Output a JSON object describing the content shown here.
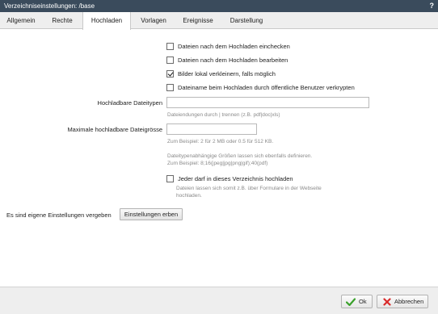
{
  "window": {
    "title": "Verzeichniseinstellungen: /base",
    "help_label": "?"
  },
  "tabs": [
    {
      "label": "Allgemein"
    },
    {
      "label": "Rechte"
    },
    {
      "label": "Hochladen",
      "active": true
    },
    {
      "label": "Vorlagen"
    },
    {
      "label": "Ereignisse"
    },
    {
      "label": "Darstellung"
    }
  ],
  "options": {
    "check_after_upload": {
      "label": "Dateien nach dem Hochladen einchecken",
      "checked": false
    },
    "edit_after_upload": {
      "label": "Dateien nach dem Hochladen bearbeiten",
      "checked": false
    },
    "resize_images": {
      "label": "Bilder lokal verkleinern, falls möglich",
      "checked": true
    },
    "encrypt_filename": {
      "label": "Dateiname beim Hochladen durch öffentliche Benutzer verkrypten",
      "checked": false
    }
  },
  "filetypes": {
    "label": "Hochladbare Dateitypen",
    "value": "",
    "hint": "Dateiendungen durch | trennen (z.B. pdf|doc|xls)"
  },
  "maxsize": {
    "label": "Maximale hochladbare Dateigrösse",
    "value": "",
    "hint1": "Zum Beispiel: 2 für 2 MB oder 0.5 für 512 KB.",
    "hint2": "Dateitypenabhängige Größen lassen sich ebenfalls definieren.",
    "hint3": "Zum Beispiel: 8;16(jpeg|jpg|png|gif);40(pdf)"
  },
  "public_upload": {
    "label": "Jeder darf in dieses Verzeichnis hochladen",
    "checked": false,
    "hint1": "Dateien lassen sich somit z.B. über Formulare in der Webseite",
    "hint2": "hochladen."
  },
  "inherit": {
    "text": "Es sind eigene Einstellungen vergeben",
    "button_label": "Einstellungen erben"
  },
  "footer": {
    "ok_label": "Ok",
    "cancel_label": "Abbrechen"
  },
  "colors": {
    "titlebar": "#3a4b5c",
    "ok_icon": "#3aa12b",
    "cancel_icon": "#d92b2b"
  },
  "icons": {
    "ok": "checkmark-icon",
    "cancel": "x-icon",
    "help": "help-icon"
  }
}
